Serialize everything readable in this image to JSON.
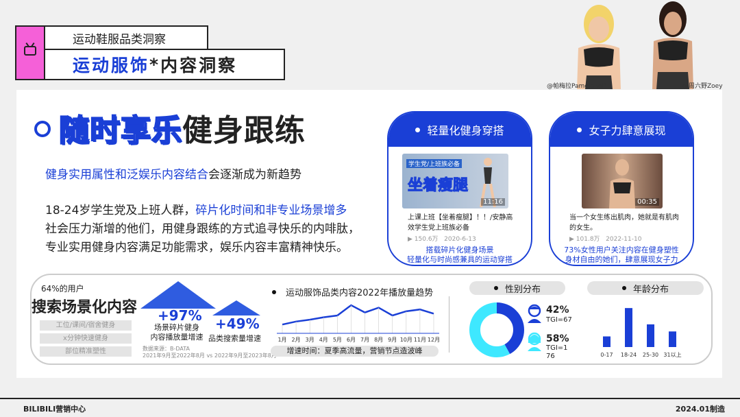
{
  "header": {
    "subtitle": "运动鞋服品类洞察",
    "title_blue": "运动服饰",
    "title_star": "*",
    "title_rest": "内容洞察"
  },
  "photo_captions": [
    "@帕梅拉PamelaReif",
    "@周六野Zoey"
  ],
  "section": {
    "title_outline": "随时享乐",
    "title_solid": "健身跟练",
    "lead_highlight": "健身实用属性和泛娱乐内容结合",
    "lead_rest": "会逐渐成为新趋势",
    "para": {
      "l1a": "18-24岁学生党及上班人群，",
      "l1b": "碎片化时间和非专业场景增多",
      "l2": "社会压力渐增的他们，用健身跟练的方式追寻快乐的内啡肽，",
      "l3": "专业实用健身内容满足功能需求，娱乐内容丰富精神快乐。"
    }
  },
  "cards": [
    {
      "head": "轻量化健身穿搭",
      "thumb_tag": "学生党/上班族必备",
      "thumb_text": "坐着瘦腿",
      "duration": "11:16",
      "title": "上课上班【坐着瘦腿】！！/安静高效学生党上班族必备",
      "views": "150.6万",
      "date": "2020-6-13",
      "foot1": "搭载碎片化健身场景",
      "foot2": "轻量化与时尚感兼具的运动穿搭"
    },
    {
      "head": "女子力肆意展现",
      "duration": "00:35",
      "title": "当一个女生练出肌肉，她就是有肌肉的女生。",
      "views": "101.8万",
      "date": "2022-11-10",
      "foot1": "73%女性用户关注内容在健身塑性",
      "foot2": "身材自由的她们，肆意展现女子力"
    }
  ],
  "search": {
    "pct_label": "64%的用户",
    "title": "搜索场景化内容",
    "tags": [
      "工位/课间/宿舍健身",
      "x分钟快速健身",
      "部位精准塑性"
    ],
    "stat1_value": "+97%",
    "stat1_l1": "场景碎片健身",
    "stat1_l2": "内容播放量增速",
    "stat2_value": "+49%",
    "stat2_label": "品类搜索量增速",
    "src1": "数据来源：B-DATA",
    "src2": "2021年9月至2022年8月 vs 2022年9月至2023年8月"
  },
  "trend": {
    "title": "运动服饰品类内容2022年播放量趋势",
    "note": "增速时间：夏季高流量，营销节点造波峰"
  },
  "gender": {
    "title": "性别分布",
    "male_pct": "42%",
    "male_tgi": "TGI=67",
    "female_pct": "58%",
    "female_tgi": "TGI=176"
  },
  "age": {
    "title": "年龄分布"
  },
  "chart_data": [
    {
      "type": "line",
      "title": "运动服饰品类内容2022年播放量趋势",
      "categories": [
        "1月",
        "2月",
        "3月",
        "4月",
        "5月",
        "6月",
        "7月",
        "8月",
        "9月",
        "10月",
        "11月",
        "12月"
      ],
      "values": [
        10,
        15,
        18,
        22,
        25,
        42,
        30,
        38,
        25,
        32,
        35,
        28
      ],
      "ylim": [
        0,
        50
      ],
      "grid": false,
      "color": "#1a3fd6"
    },
    {
      "type": "pie",
      "title": "性别分布",
      "labels": [
        "42%",
        "58%"
      ],
      "values": [
        42,
        58
      ],
      "colors": [
        "#1a3fd6",
        "#3ee8ff"
      ]
    },
    {
      "type": "bar",
      "title": "年龄分布",
      "categories": [
        "0-17",
        "18-24",
        "25-30",
        "31以上"
      ],
      "values": [
        15,
        55,
        32,
        22
      ],
      "ylim": [
        0,
        60
      ],
      "color": "#1a3fd6"
    }
  ],
  "footer": {
    "left": "BILIBILI营销中心",
    "right": "2024.01制造"
  },
  "colors": {
    "brand_blue": "#1a3fd6",
    "cyan": "#3ee8ff",
    "pink": "#f560d8"
  }
}
